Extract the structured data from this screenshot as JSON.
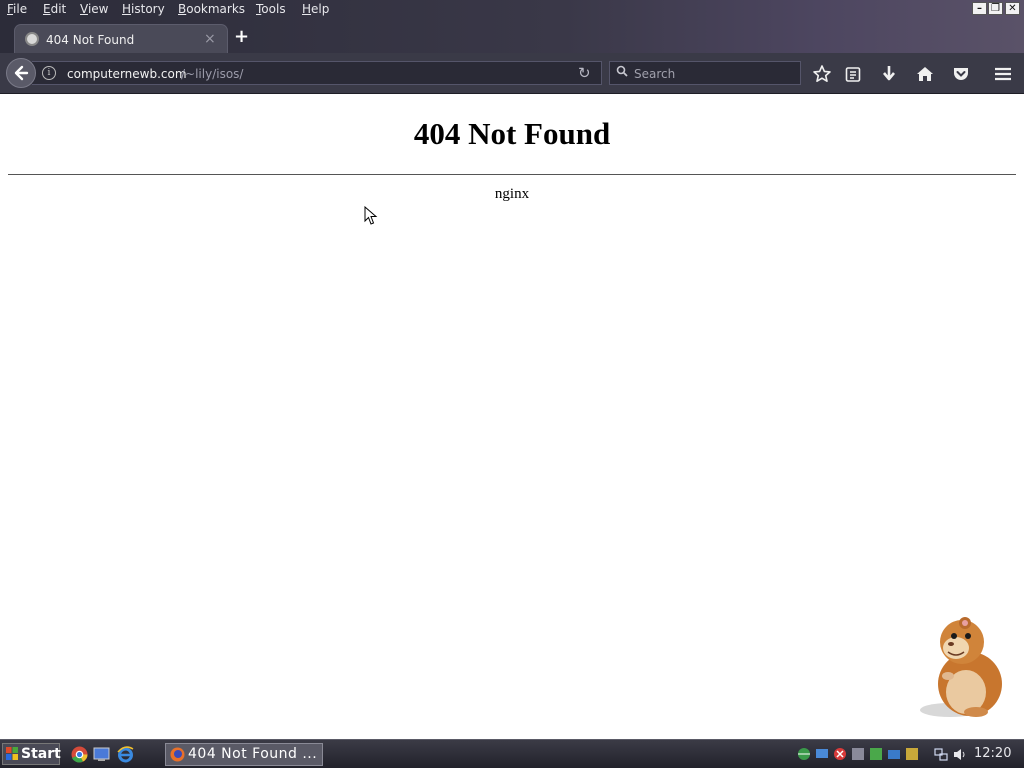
{
  "menubar": {
    "items": [
      "File",
      "Edit",
      "View",
      "History",
      "Bookmarks",
      "Tools",
      "Help"
    ]
  },
  "window_controls": {
    "minimize": "–",
    "restore": "❐",
    "close": "✕"
  },
  "tab": {
    "title": "404 Not Found",
    "close_glyph": "×",
    "new_tab_glyph": "+"
  },
  "navbar": {
    "back_glyph": "🡐",
    "info_glyph": "i",
    "url_host": "computernewb.com",
    "url_path": "/~lily/isos/",
    "reload_glyph": "↻",
    "search_placeholder": "Search",
    "icons": [
      "bookmark-star-icon",
      "reading-list-icon",
      "downloads-icon",
      "home-icon",
      "pocket-icon",
      "menu-hamburger-icon"
    ]
  },
  "page": {
    "heading": "404 Not Found",
    "server": "nginx"
  },
  "taskbar": {
    "start_label": "Start",
    "task_label": "404 Not Found ...",
    "clock": "12:20"
  },
  "colors": {
    "chrome_dark": "#2c2c39",
    "navbar": "#3a3a47",
    "page_bg": "#ffffff",
    "taskbar": "#22222b"
  }
}
